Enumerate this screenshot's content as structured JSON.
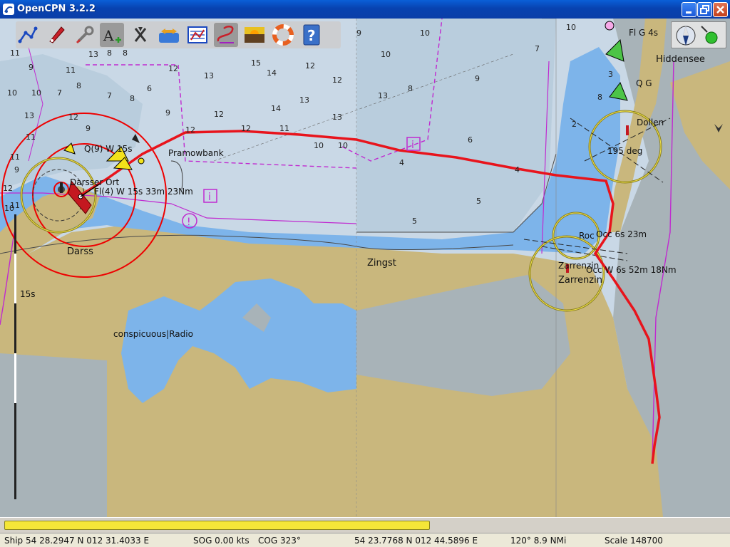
{
  "window": {
    "title": "OpenCPN 3.2.2"
  },
  "toolbar": {
    "buttons": [
      {
        "name": "route-tool"
      },
      {
        "name": "ship-follow"
      },
      {
        "name": "settings"
      },
      {
        "name": "text-toggle"
      },
      {
        "name": "ais-toggle"
      },
      {
        "name": "current-tide"
      },
      {
        "name": "route-manager"
      },
      {
        "name": "track-toggle"
      },
      {
        "name": "color-scheme"
      },
      {
        "name": "man-overboard"
      },
      {
        "name": "help"
      }
    ]
  },
  "chart": {
    "place_labels": [
      "Darss",
      "Zingst",
      "Zarrenzin",
      "Hiddensee",
      "Pramowbank"
    ],
    "light_labels": [
      "Darsser Ort",
      "Fl(4) W 15s 33m 23Nm",
      "Q(9) W 15s",
      "Occ 6s 23m",
      "Occ W 6s 52m 18Nm",
      "Zarrenzin",
      "conspicuous|Radio",
      "Fl G 4s",
      "Q G",
      "Dollen",
      "195 deg",
      "Roc",
      "15s"
    ],
    "soundings": [
      "11",
      "9",
      "10",
      "7",
      "10",
      "8",
      "13",
      "12",
      "11",
      "9",
      "10",
      "7",
      "6",
      "8",
      "9",
      "13",
      "11",
      "8",
      "8",
      "12",
      "15",
      "13",
      "9",
      "12",
      "14",
      "13",
      "14",
      "12",
      "10",
      "13",
      "10",
      "8",
      "13",
      "7",
      "12",
      "11",
      "12",
      "12",
      "10",
      "10",
      "11",
      "9",
      "6",
      "10",
      "9",
      "4",
      "5",
      "3",
      "12",
      "11",
      "8",
      "5",
      "4",
      "2"
    ],
    "route_color": "#e8141c"
  },
  "status": {
    "ship": "Ship 54 28.2947 N   012 31.4033 E",
    "sog": "SOG 0.00 kts",
    "cog": "COG 323°",
    "cursor": "54 23.7768 N   012 44.5896 E",
    "bearing": "120°  8.9 NMi",
    "scale": "Scale 148700"
  },
  "scroll": {
    "progress": 0.59
  }
}
